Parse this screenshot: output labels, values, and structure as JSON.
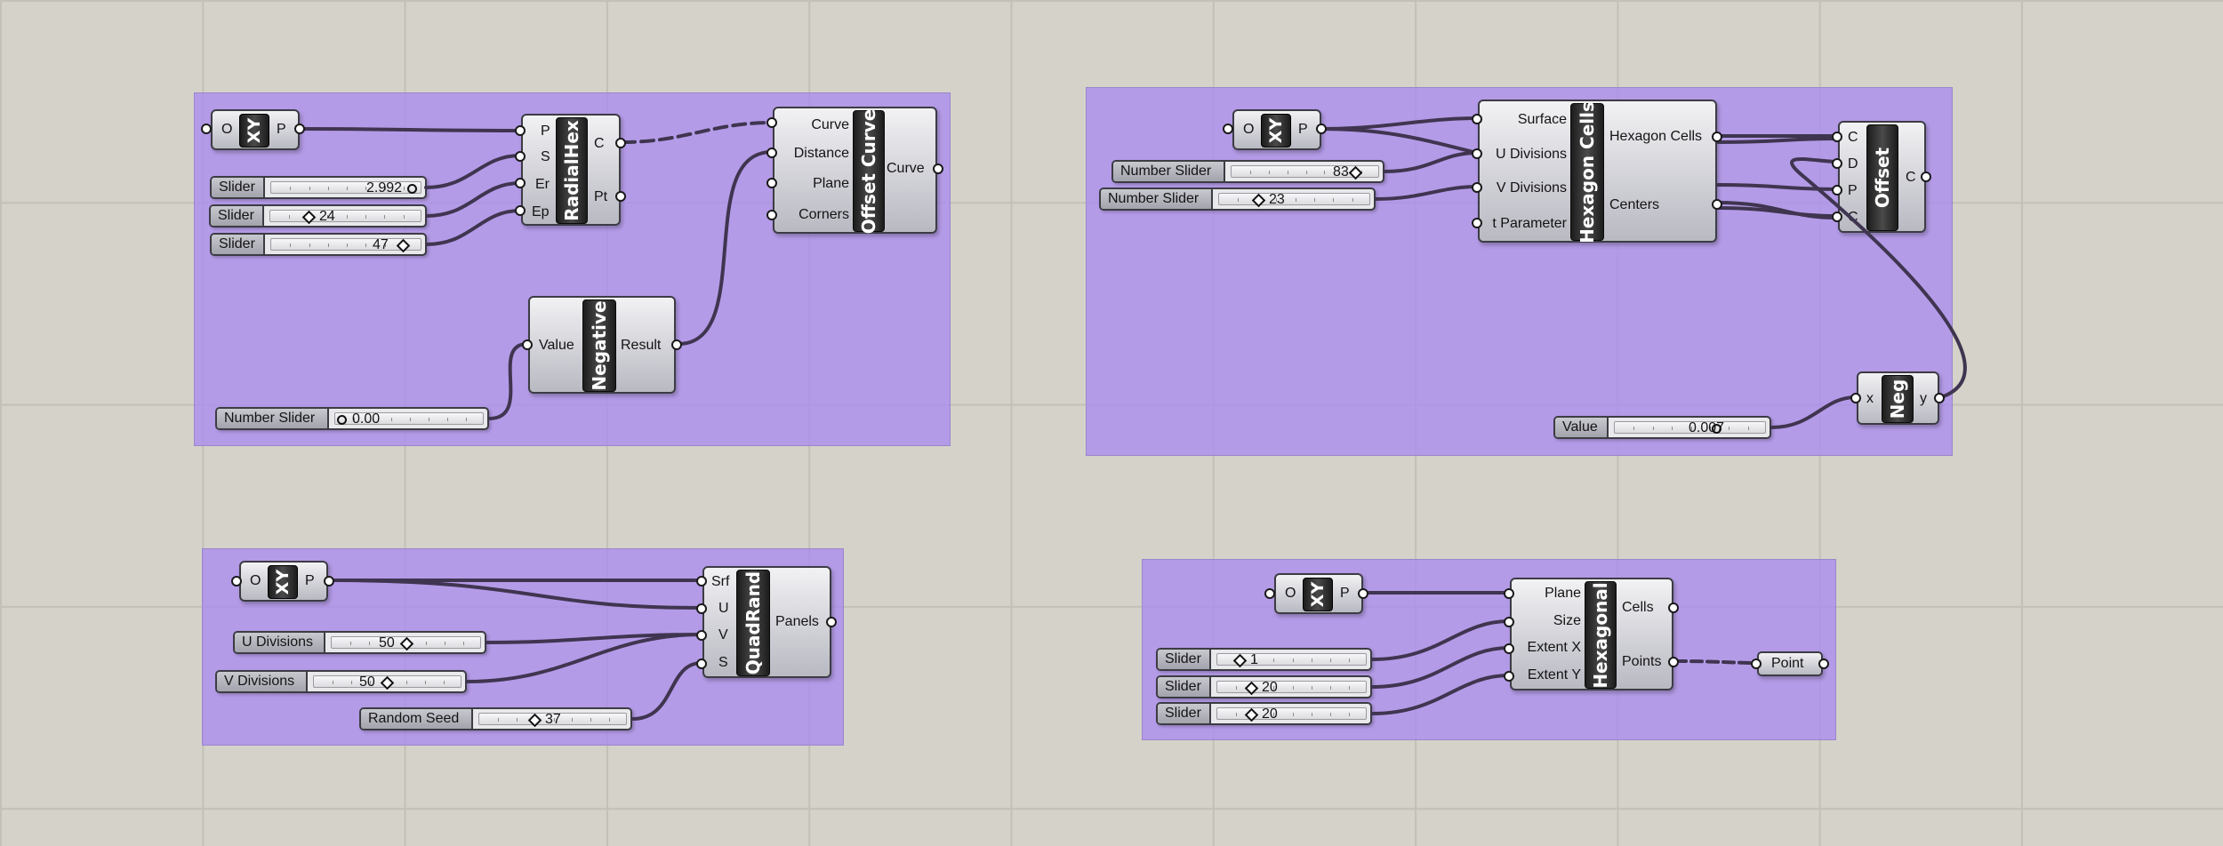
{
  "canvas": {
    "background": "#d5d2c9",
    "group_color": "#aa8cf0"
  },
  "components": {
    "xy1": {
      "label": "XY",
      "in": "O",
      "out": "P"
    },
    "xy2": {
      "label": "XY",
      "in": "O",
      "out": "P"
    },
    "xy3": {
      "label": "XY",
      "in": "O",
      "out": "P"
    },
    "xy4": {
      "label": "XY",
      "in": "O",
      "out": "P"
    },
    "radialhex": {
      "label": "RadialHex",
      "inputs": [
        "P",
        "S",
        "Er",
        "Ep"
      ],
      "outputs": [
        "C",
        "Pt"
      ]
    },
    "offsetcurve": {
      "label": "Offset Curve",
      "inputs": [
        "Curve",
        "Distance",
        "Plane",
        "Corners"
      ],
      "outputs": [
        "Curve"
      ]
    },
    "negative": {
      "label": "Negative",
      "inputs": [
        "Value"
      ],
      "outputs": [
        "Result"
      ]
    },
    "hexcells": {
      "label": "Hexagon Cells",
      "inputs": [
        "Surface",
        "U Divisions",
        "V Divisions",
        "t Parameter"
      ],
      "outputs": [
        "Hexagon Cells",
        "Centers"
      ]
    },
    "offset": {
      "label": "Offset",
      "inputs": [
        "C",
        "D",
        "P",
        "C"
      ],
      "outputs": [
        "C"
      ]
    },
    "neg": {
      "label": "Neg",
      "inputs": [
        "x"
      ],
      "outputs": [
        "y"
      ]
    },
    "quadrand": {
      "label": "QuadRand",
      "inputs": [
        "Srf",
        "U",
        "V",
        "S"
      ],
      "outputs": [
        "Panels"
      ]
    },
    "hexagonal": {
      "label": "Hexagonal",
      "inputs": [
        "Plane",
        "Size",
        "Extent X",
        "Extent Y"
      ],
      "outputs": [
        "Cells",
        "Points"
      ]
    },
    "point": {
      "label": "Point"
    }
  },
  "sliders": {
    "s1": {
      "name": "Slider",
      "value": "2.992"
    },
    "s2": {
      "name": "Slider",
      "value": "24"
    },
    "s3": {
      "name": "Slider",
      "value": "47"
    },
    "s4": {
      "name": "Number Slider",
      "value": "0.00"
    },
    "s5": {
      "name": "Number Slider",
      "value": "83"
    },
    "s6": {
      "name": "Number Slider",
      "value": "23"
    },
    "s7": {
      "name": "Value",
      "value": "0.007"
    },
    "s8": {
      "name": "U Divisions",
      "value": "50"
    },
    "s9": {
      "name": "V Divisions",
      "value": "50"
    },
    "s10": {
      "name": "Random Seed",
      "value": "37"
    },
    "s11": {
      "name": "Slider",
      "value": "1"
    },
    "s12": {
      "name": "Slider",
      "value": "20"
    },
    "s13": {
      "name": "Slider",
      "value": "20"
    }
  }
}
